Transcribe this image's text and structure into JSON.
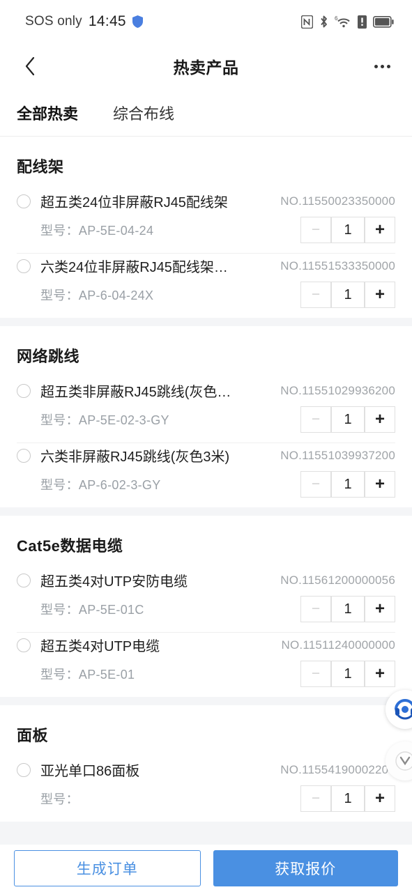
{
  "statusbar": {
    "carrier": "SOS only",
    "time": "14:45",
    "icons": [
      "shield-icon",
      "nfc-icon",
      "bluetooth-icon",
      "wifi-6-icon",
      "sim-alert-icon",
      "battery-icon"
    ]
  },
  "navbar": {
    "back_icon": "chevron-left-icon",
    "title": "热卖产品",
    "more_icon": "more-horizontal-icon"
  },
  "tabs": [
    {
      "label": "全部热卖",
      "active": true
    },
    {
      "label": "综合布线",
      "active": false
    }
  ],
  "labels": {
    "model_prefix": "型号：",
    "no_prefix": "NO.",
    "minus": "−",
    "plus": "+"
  },
  "sections": [
    {
      "title": "配线架",
      "products": [
        {
          "name": "超五类24位非屏蔽RJ45配线架",
          "no": "NO.11550023350000",
          "model": "型号：AP-5E-04-24",
          "qty": "1"
        },
        {
          "name": "六类24位非屏蔽RJ45配线架…",
          "no": "NO.11551533350000",
          "model": "型号：AP-6-04-24X",
          "qty": "1"
        }
      ]
    },
    {
      "title": "网络跳线",
      "products": [
        {
          "name": "超五类非屏蔽RJ45跳线(灰色…",
          "no": "NO.11551029936200",
          "model": "型号：AP-5E-02-3-GY",
          "qty": "1"
        },
        {
          "name": "六类非屏蔽RJ45跳线(灰色3米)",
          "no": "NO.11551039937200",
          "model": "型号：AP-6-02-3-GY",
          "qty": "1"
        }
      ]
    },
    {
      "title": "Cat5e数据电缆",
      "products": [
        {
          "name": "超五类4对UTP安防电缆",
          "no": "NO.11561200000056",
          "model": "型号：AP-5E-01C",
          "qty": "1"
        },
        {
          "name": "超五类4对UTP电缆",
          "no": "NO.11511240000000",
          "model": "型号：AP-5E-01",
          "qty": "1"
        }
      ]
    },
    {
      "title": "面板",
      "products": [
        {
          "name": "亚光单口86面板",
          "no": "NO.11554190002200",
          "model": "型号：",
          "qty": "1"
        }
      ]
    }
  ],
  "floating": {
    "support_icon": "headset-support-icon",
    "secondary_icon": "circle-widget-icon"
  },
  "bottombar": {
    "create_order": "生成订单",
    "get_quote": "获取报价"
  },
  "colors": {
    "accent": "#4a90e2",
    "page_bg": "#f4f5f7",
    "text_primary": "#1f1f1f",
    "text_muted": "#9aa0a6"
  }
}
